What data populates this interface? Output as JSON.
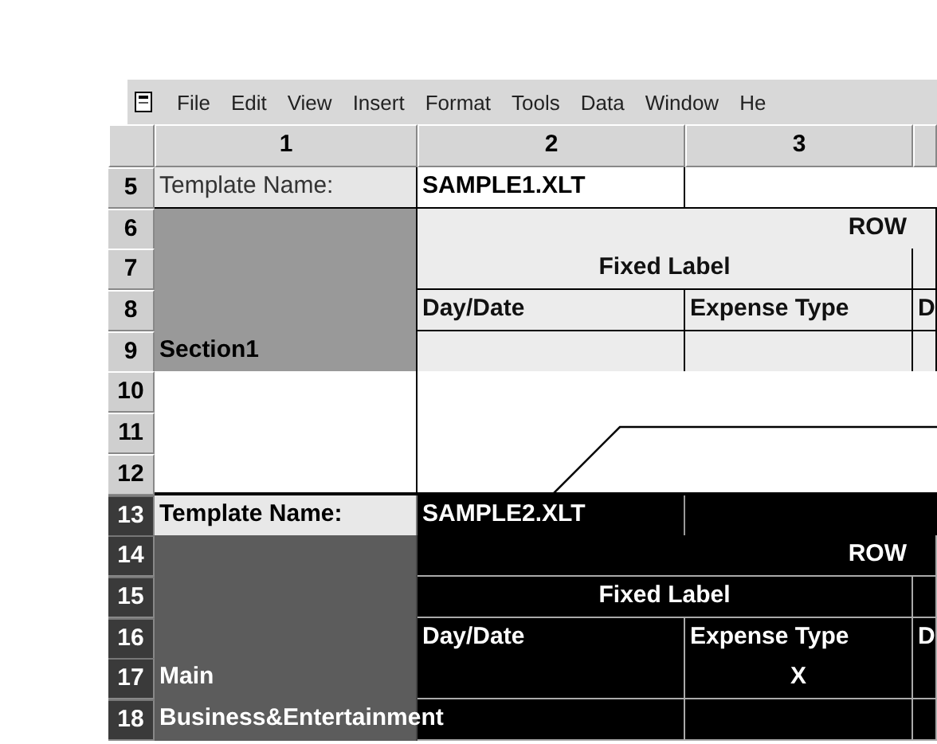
{
  "menu": [
    "File",
    "Edit",
    "View",
    "Insert",
    "Format",
    "Tools",
    "Data",
    "Window",
    "He"
  ],
  "column_headers": [
    "1",
    "2",
    "3"
  ],
  "rows": [
    {
      "number": "5",
      "inverted": false,
      "cells": [
        {
          "kind": "label",
          "text": "Template Name:"
        },
        {
          "kind": "value",
          "text": "SAMPLE1.XLT"
        },
        {
          "kind": "blank"
        },
        {
          "kind": "blank"
        }
      ]
    },
    {
      "number": "6",
      "inverted": false,
      "cells": [
        {
          "kind": "shade"
        },
        {
          "kind": "heading",
          "text": "ROW"
        }
      ]
    },
    {
      "number": "7",
      "inverted": false,
      "cells": [
        {
          "kind": "shade"
        },
        {
          "kind": "caption",
          "text": "Fixed Label"
        },
        {
          "kind": "band"
        }
      ]
    },
    {
      "number": "8",
      "inverted": false,
      "cells": [
        {
          "kind": "shade"
        },
        {
          "kind": "band",
          "text": "Day/Date"
        },
        {
          "kind": "band",
          "text": "Expense Type"
        },
        {
          "kind": "band",
          "text": "D"
        }
      ]
    },
    {
      "number": "9",
      "inverted": false,
      "cells": [
        {
          "kind": "shade",
          "text": "Section1"
        },
        {
          "kind": "band"
        },
        {
          "kind": "band"
        },
        {
          "kind": "band"
        }
      ]
    },
    {
      "number": "10",
      "inverted": false,
      "cells": [
        {
          "kind": "open"
        },
        {
          "kind": "gap"
        },
        {
          "kind": "gap"
        },
        {
          "kind": "gap"
        }
      ]
    },
    {
      "number": "11",
      "inverted": false,
      "cells": [
        {
          "kind": "open"
        },
        {
          "kind": "gap"
        },
        {
          "kind": "gap"
        },
        {
          "kind": "gap"
        }
      ]
    },
    {
      "number": "12",
      "inverted": false,
      "cells": [
        {
          "kind": "open"
        },
        {
          "kind": "gap"
        },
        {
          "kind": "gap"
        },
        {
          "kind": "gap"
        }
      ]
    },
    {
      "number": "13",
      "inverted": true,
      "cells": [
        {
          "kind": "label",
          "text": "Template Name:"
        },
        {
          "kind": "value",
          "text": "SAMPLE2.XLT"
        },
        {
          "kind": "blank"
        },
        {
          "kind": "blank"
        }
      ]
    },
    {
      "number": "14",
      "inverted": true,
      "cells": [
        {
          "kind": "shade"
        },
        {
          "kind": "heading",
          "text": "ROW"
        }
      ]
    },
    {
      "number": "15",
      "inverted": true,
      "cells": [
        {
          "kind": "shade"
        },
        {
          "kind": "caption",
          "text": "Fixed Label"
        },
        {
          "kind": "band"
        }
      ]
    },
    {
      "number": "16",
      "inverted": true,
      "cells": [
        {
          "kind": "shade"
        },
        {
          "kind": "band",
          "text": "Day/Date"
        },
        {
          "kind": "band",
          "text": "Expense Type"
        },
        {
          "kind": "band",
          "text": "D"
        }
      ]
    },
    {
      "number": "17",
      "inverted": true,
      "cells": [
        {
          "kind": "shade",
          "text": "Main"
        },
        {
          "kind": "band"
        },
        {
          "kind": "mark",
          "text": "X"
        },
        {
          "kind": "band"
        }
      ]
    },
    {
      "number": "18",
      "inverted": true,
      "cells": [
        {
          "kind": "shade",
          "text": "Business&Entertainment"
        },
        {
          "kind": "band"
        },
        {
          "kind": "band"
        },
        {
          "kind": "band"
        }
      ]
    }
  ]
}
